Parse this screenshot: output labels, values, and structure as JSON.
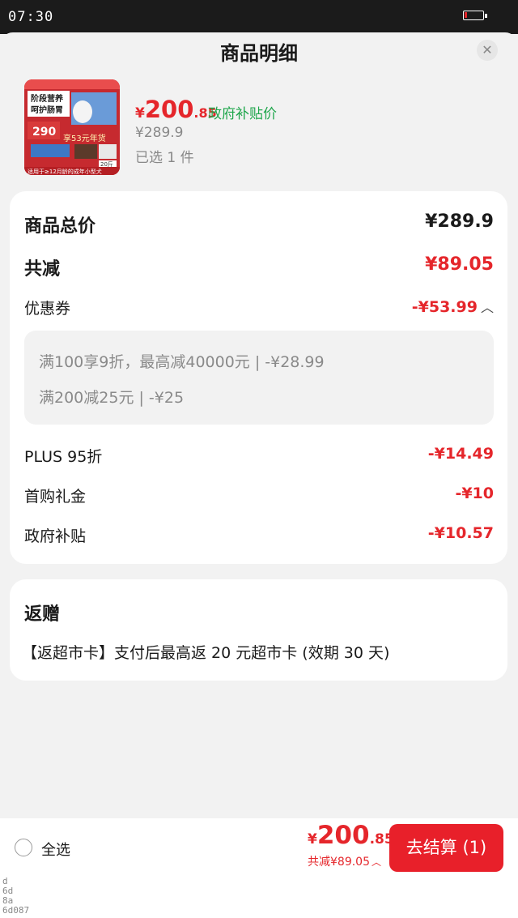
{
  "status_bar": {
    "time": "07:30",
    "battery_level": 0.15,
    "battery_color": "#e5262b"
  },
  "header": {
    "title": "商品明细",
    "close_icon": "close-icon"
  },
  "product": {
    "image_alt": "dog-food-product-image",
    "price_currency": "¥",
    "price_int": "200",
    "price_dec": ".85",
    "price_tag": "政府补贴价",
    "original_price": "¥289.9",
    "selected_count": "已选 1 件",
    "image_text": {
      "headline": "阶段营养\n呵护肠胃",
      "promo": "享53元年货",
      "price": "290",
      "weight": "20斤",
      "footer": "适用于≥12月龄的成年小型犬"
    }
  },
  "summary": {
    "total_label": "商品总价",
    "total_value": "¥289.9",
    "discount_label": "共减",
    "discount_value": "¥89.05",
    "coupon_label": "优惠券",
    "coupon_value": "-¥53.99",
    "coupon_lines": [
      "满100享9折，最高减40000元 | -¥28.99",
      "满200减25元 | -¥25"
    ],
    "plus_label": "PLUS 95折",
    "plus_value": "-¥14.49",
    "first_label": "首购礼金",
    "first_value": "-¥10",
    "gov_label": "政府补贴",
    "gov_value": "-¥10.57"
  },
  "gift": {
    "title": "返赠",
    "text": "【返超市卡】支付后最高返 20 元超市卡 (效期 30 天)"
  },
  "bottom": {
    "select_all": "全选",
    "total_currency": "¥",
    "total_int": "200",
    "total_dec": ".85",
    "discount_text": "共减¥89.05",
    "checkout_label": "去结算 (1)"
  },
  "debug_lines": [
    "d",
    "6d",
    "8a",
    "6d087"
  ],
  "colors": {
    "accent": "#e5262b",
    "green": "#1fa64c",
    "checkout": "#e8202a"
  }
}
